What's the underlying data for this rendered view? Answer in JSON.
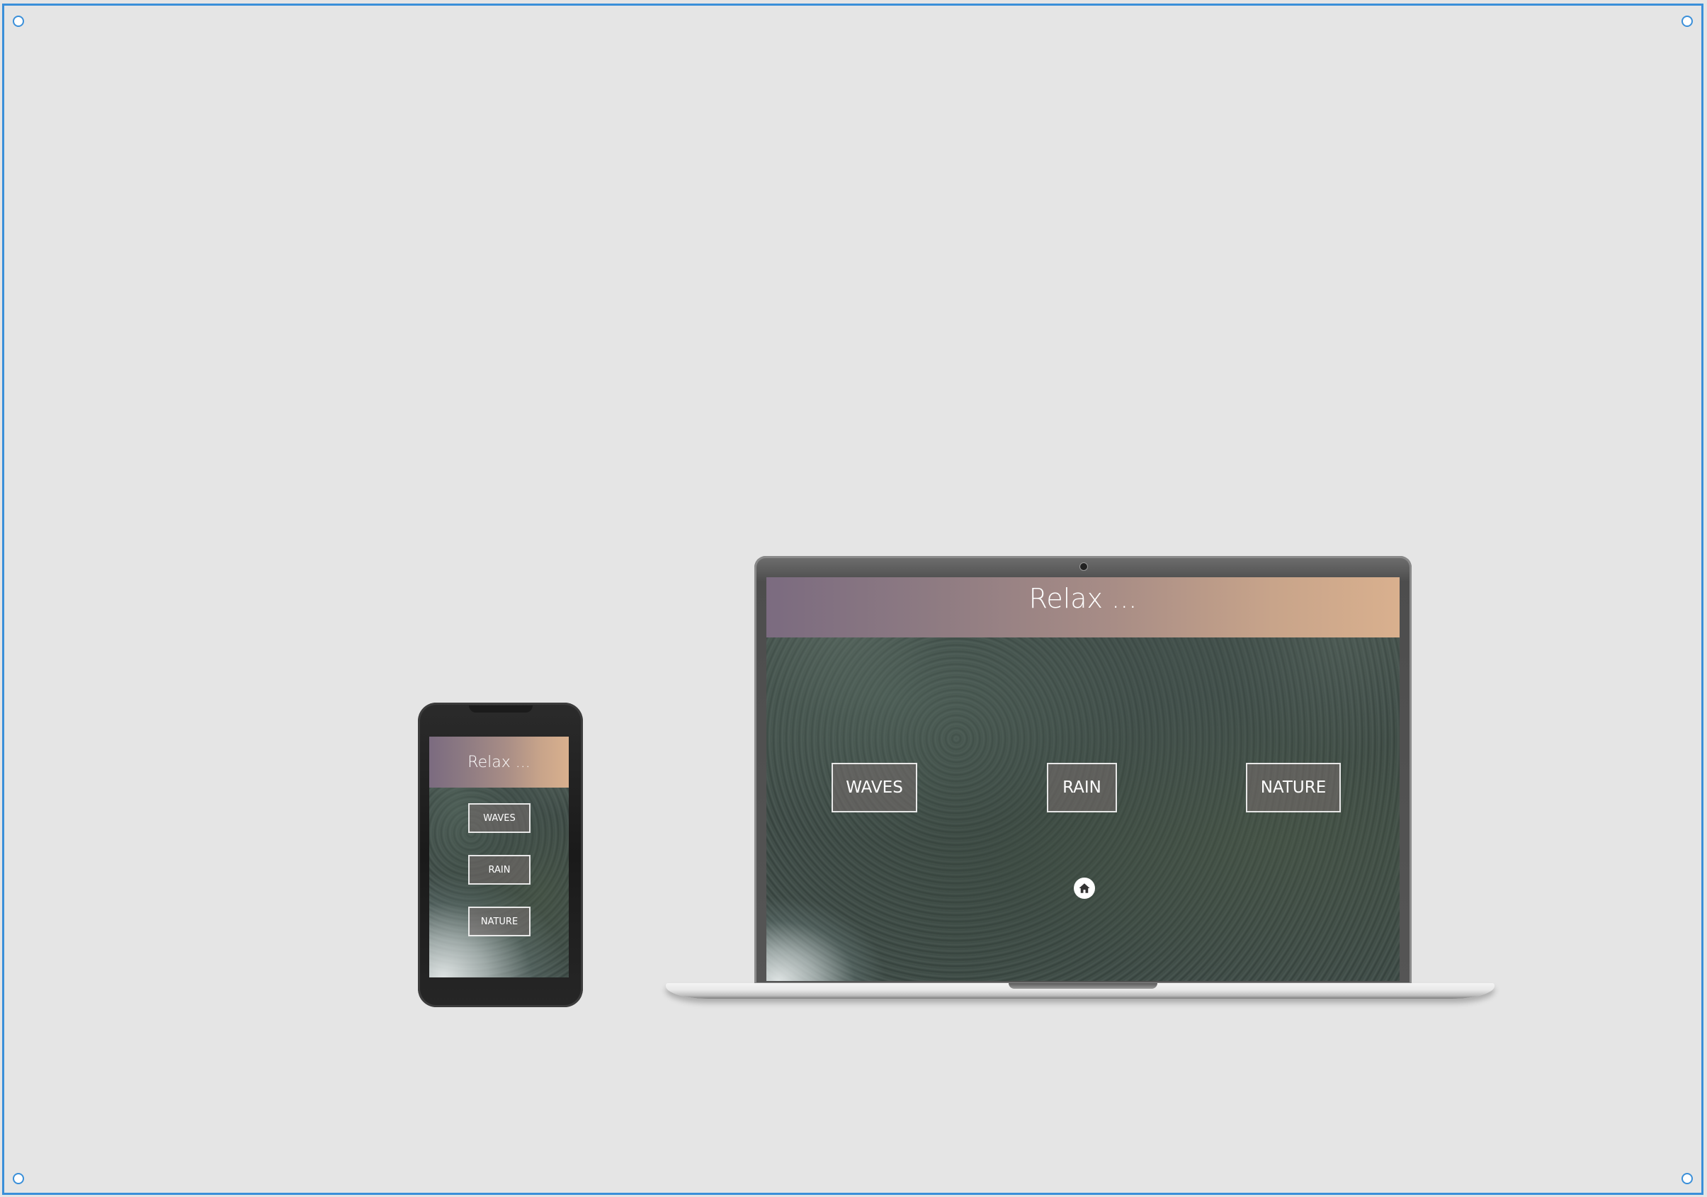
{
  "mobile": {
    "title": "Relax ...",
    "buttons": [
      "WAVES",
      "RAIN",
      "NATURE"
    ]
  },
  "desktop": {
    "title": "Relax ...",
    "buttons": [
      "WAVES",
      "RAIN",
      "NATURE"
    ],
    "home_icon": "home-icon"
  },
  "colors": {
    "selection_accent": "#3a8fd9",
    "canvas_background": "#e5e5e5",
    "banner_gradient_start": "#7b6b80",
    "banner_gradient_end": "#d9b08e",
    "forest_base": "#3f4b47"
  },
  "icons": {
    "selection_handles": "circle-handle-icon",
    "home": "home-icon"
  }
}
